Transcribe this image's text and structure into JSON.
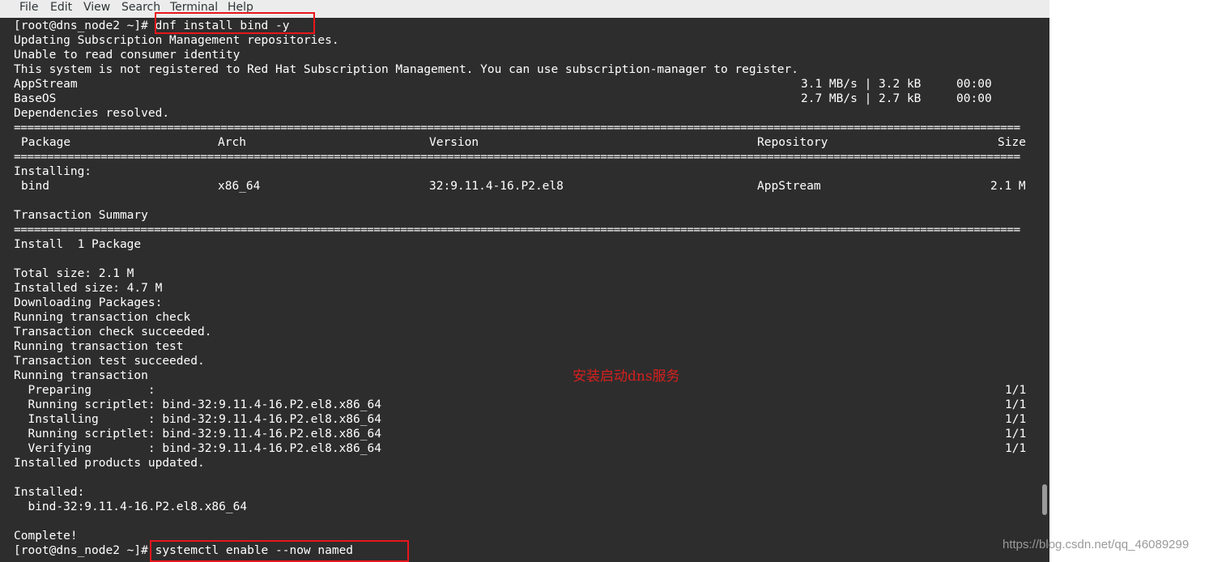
{
  "menubar": {
    "items": [
      "File",
      "Edit",
      "View",
      "Search",
      "Terminal",
      "Help"
    ]
  },
  "terminal": {
    "prompt": "[root@dns_node2 ~]#",
    "commands": {
      "install": "dnf install bind -y",
      "enable": "systemctl enable --now named"
    },
    "lines": {
      "l2": "Updating Subscription Management repositories.",
      "l3": "Unable to read consumer identity",
      "l4": "This system is not registered to Red Hat Subscription Management. You can use subscription-manager to register.",
      "repo1_name": "AppStream",
      "repo1_stats": "3.1 MB/s | 3.2 kB     00:00",
      "repo2_name": "BaseOS",
      "repo2_stats": "2.7 MB/s | 2.7 kB     00:00",
      "l7": "Dependencies resolved.",
      "rule": "=======================================================================================================================================================",
      "col_package": "Package",
      "col_arch": "Arch",
      "col_version": "Version",
      "col_repository": "Repository",
      "col_size": "Size",
      "installing_header": "Installing:",
      "pkg_name": "bind",
      "pkg_arch": "x86_64",
      "pkg_version": "32:9.11.4-16.P2.el8",
      "pkg_repo": "AppStream",
      "pkg_size": "2.1 M",
      "summary_header": "Transaction Summary",
      "install_count": "Install  1 Package",
      "total_size": "Total size: 2.1 M",
      "installed_size": "Installed size: 4.7 M",
      "downloading": "Downloading Packages:",
      "run_check": "Running transaction check",
      "check_ok": "Transaction check succeeded.",
      "run_test": "Running transaction test",
      "test_ok": "Transaction test succeeded.",
      "run_tx": "Running transaction",
      "step1": "  Preparing        :",
      "step1_count": "1/1",
      "step2": "  Running scriptlet: bind-32:9.11.4-16.P2.el8.x86_64",
      "step2_count": "1/1",
      "step3": "  Installing       : bind-32:9.11.4-16.P2.el8.x86_64",
      "step3_count": "1/1",
      "step4": "  Running scriptlet: bind-32:9.11.4-16.P2.el8.x86_64",
      "step4_count": "1/1",
      "step5": "  Verifying        : bind-32:9.11.4-16.P2.el8.x86_64",
      "step5_count": "1/1",
      "products_updated": "Installed products updated.",
      "installed_header": "Installed:",
      "installed_pkg": "  bind-32:9.11.4-16.P2.el8.x86_64",
      "complete": "Complete!"
    }
  },
  "annotation": {
    "text": "安装启动dns服务",
    "color": "#d6201e"
  },
  "watermark": {
    "text": "https://blog.csdn.net/qq_46089299"
  },
  "colors": {
    "terminal_bg": "#2d2d2d",
    "terminal_fg": "#ffffff",
    "menubar_bg": "#ececec",
    "highlight_box": "#e8161c"
  }
}
